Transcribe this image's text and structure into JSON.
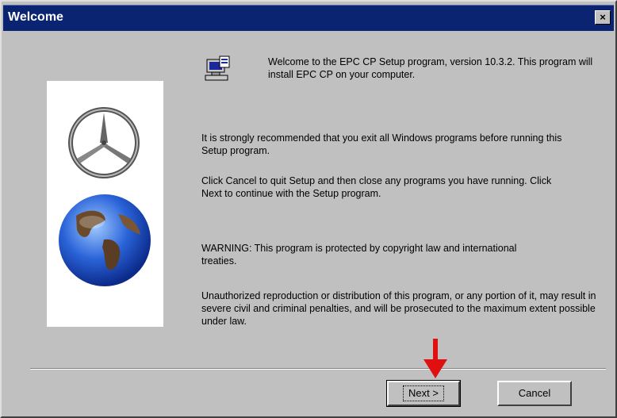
{
  "window": {
    "title": "Welcome",
    "close_glyph": "×"
  },
  "content": {
    "welcome_text": "Welcome to the EPC CP Setup program, version 10.3.2. This program will install EPC CP on your computer.",
    "recommend_text": "It is strongly recommended that you exit all Windows programs before running this Setup program.",
    "cancel_text": "Click Cancel to quit Setup and then close any programs you have running.  Click Next to continue with the Setup program.",
    "warning_text": "WARNING: This program is protected by copyright law and international treaties.",
    "unauthorized_text": "Unauthorized reproduction or distribution of this program, or any portion of it, may result in severe civil and criminal penalties, and will be prosecuted to the maximum extent possible under law."
  },
  "buttons": {
    "next_label": "Next >",
    "cancel_label": "Cancel"
  },
  "icons": {
    "logo": "star-logo-icon",
    "globe": "globe-icon",
    "setup": "setup-computer-icon",
    "arrow": "red-arrow-down-icon",
    "close": "close-icon"
  },
  "colors": {
    "titlebar": "#0a2472",
    "dialog_bg": "#c0c0c0",
    "arrow": "#e01010"
  }
}
